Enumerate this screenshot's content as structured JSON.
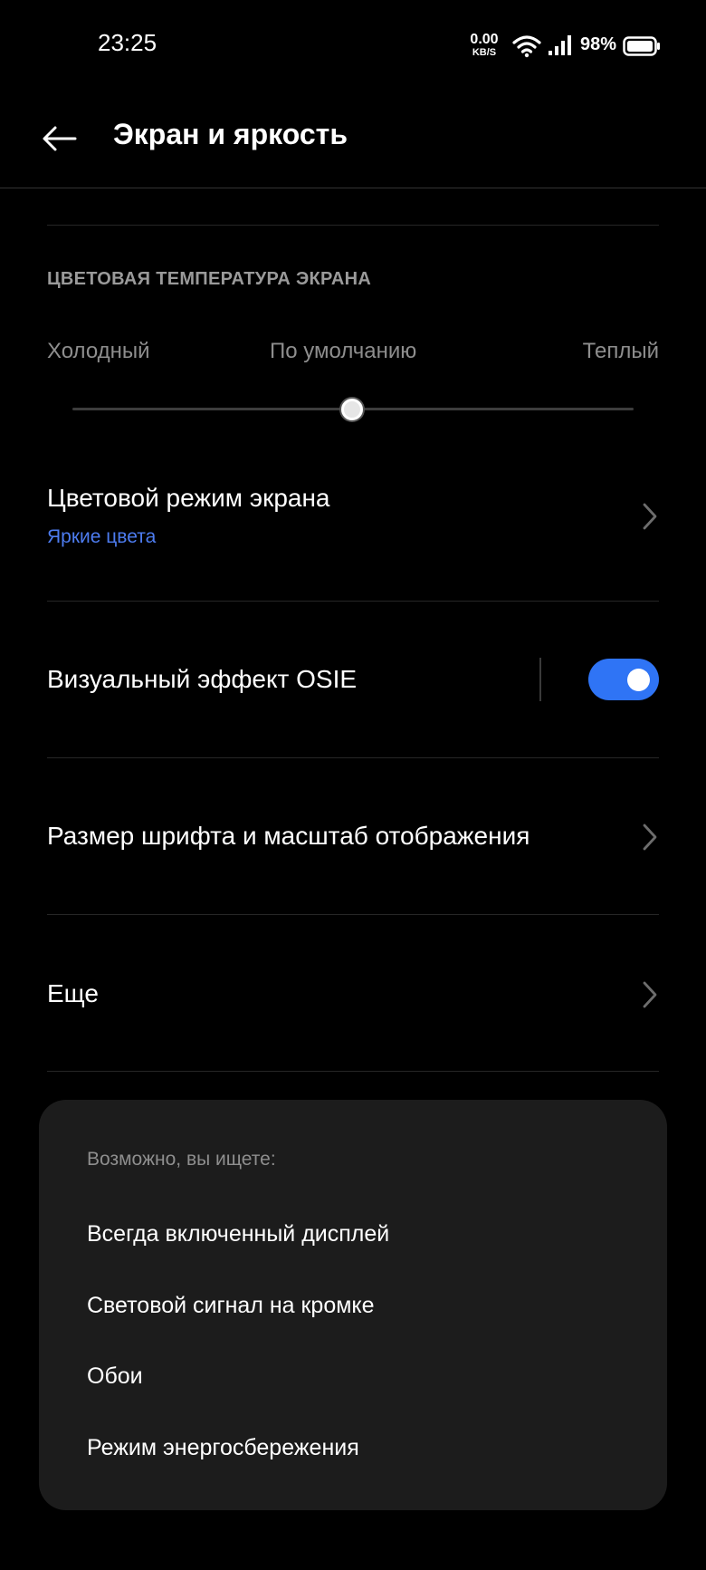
{
  "status_bar": {
    "time": "23:25",
    "net_speed_value": "0.00",
    "net_speed_unit": "KB/S",
    "battery_percent": "98%",
    "icons": [
      "wifi-icon",
      "signal-icon",
      "battery-icon"
    ]
  },
  "header": {
    "title": "Экран и яркость",
    "back_icon": "back-arrow-icon"
  },
  "color_temperature": {
    "section_title": "ЦВЕТОВАЯ ТЕМПЕРАТУРА ЭКРАНА",
    "label_cold": "Холодный",
    "label_default": "По умолчанию",
    "label_warm": "Теплый",
    "slider_value": 0.5
  },
  "rows": {
    "color_mode": {
      "title": "Цветовой режим экрана",
      "subtitle": "Яркие цвета"
    },
    "osie": {
      "title": "Визуальный эффект OSIE",
      "enabled": true
    },
    "font_size": {
      "title": "Размер шрифта и масштаб отображения"
    },
    "more": {
      "title": "Еще"
    }
  },
  "suggestions": {
    "title": "Возможно, вы ищете:",
    "items": [
      "Всегда включенный дисплей",
      "Световой сигнал на кромке",
      "Обои",
      "Режим энергосбережения"
    ]
  },
  "colors": {
    "background": "#000000",
    "accent": "#2f74f5",
    "subtitle_blue": "#4d7cf0",
    "card": "#1c1c1c"
  }
}
